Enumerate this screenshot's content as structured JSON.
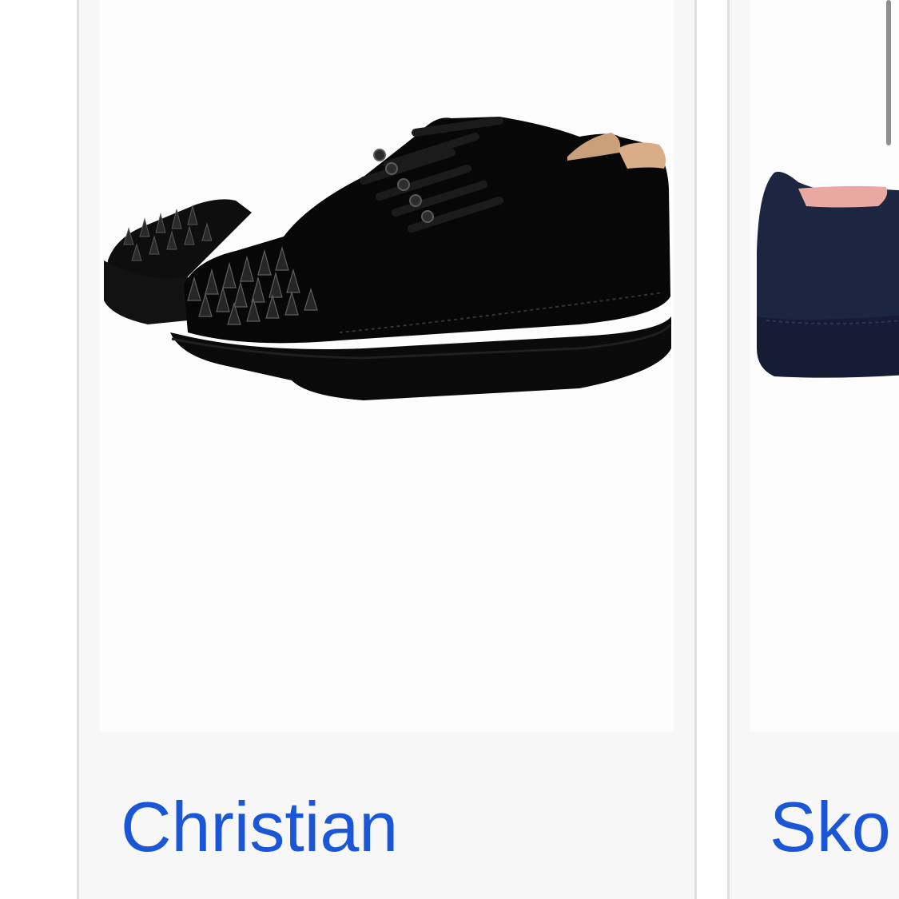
{
  "products": [
    {
      "title": "Christian",
      "image_icon": "black-spiked-sneaker-image",
      "colors": {
        "title": "#1a56d6"
      }
    },
    {
      "title": "Sko",
      "image_icon": "navy-suede-shoe-image",
      "colors": {
        "title": "#1a56d6"
      }
    }
  ]
}
